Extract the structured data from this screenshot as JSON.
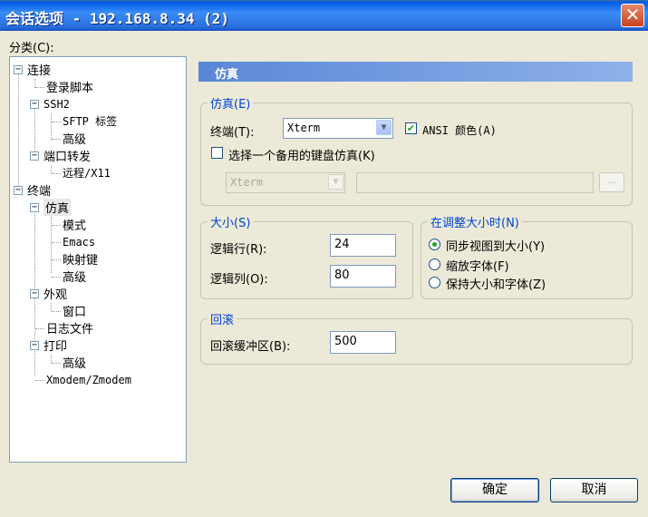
{
  "window": {
    "title": "会话选项 - 192.168.8.34 (2)",
    "close_glyph": "✕"
  },
  "category_label": "分类(C):",
  "tree": {
    "items": [
      {
        "label": "连接",
        "toggle": "−"
      },
      {
        "label": "登录脚本"
      },
      {
        "label": "SSH2",
        "toggle": "−"
      },
      {
        "label": "SFTP 标签"
      },
      {
        "label": "高级"
      },
      {
        "label": "端口转发",
        "toggle": "−"
      },
      {
        "label": "远程/X11"
      },
      {
        "label": "终端",
        "toggle": "−"
      },
      {
        "label": "仿真",
        "toggle": "−",
        "selected": true
      },
      {
        "label": "模式"
      },
      {
        "label": "Emacs"
      },
      {
        "label": "映射键"
      },
      {
        "label": "高级"
      },
      {
        "label": "外观",
        "toggle": "−"
      },
      {
        "label": "窗口"
      },
      {
        "label": "日志文件"
      },
      {
        "label": "打印",
        "toggle": "−"
      },
      {
        "label": "高级"
      },
      {
        "label": "Xmodem/Zmodem"
      }
    ]
  },
  "panel": {
    "header": "仿真",
    "emulation": {
      "legend": "仿真(E)",
      "terminal_label": "终端(T):",
      "terminal_value": "Xterm",
      "ansi_color_label": "ANSI 颜色(A)",
      "ansi_color_checked": "✔",
      "alt_keyboard_label": "选择一个备用的键盘仿真(K)",
      "alt_keyboard_value": "Xterm",
      "browse_label": "..."
    },
    "size": {
      "legend": "大小(S)",
      "logical_rows_label": "逻辑行(R):",
      "logical_rows_value": "24",
      "logical_cols_label": "逻辑列(O):",
      "logical_cols_value": "80"
    },
    "resize": {
      "legend": "在调整大小时(N)",
      "options": [
        {
          "label": "同步视图到大小(Y)",
          "selected": true
        },
        {
          "label": "缩放字体(F)",
          "selected": false
        },
        {
          "label": "保持大小和字体(Z)",
          "selected": false
        }
      ]
    },
    "scrollback": {
      "legend": "回滚",
      "buffer_label": "回滚缓冲区(B):",
      "buffer_value": "500"
    }
  },
  "buttons": {
    "ok": "确定",
    "cancel": "取消"
  }
}
